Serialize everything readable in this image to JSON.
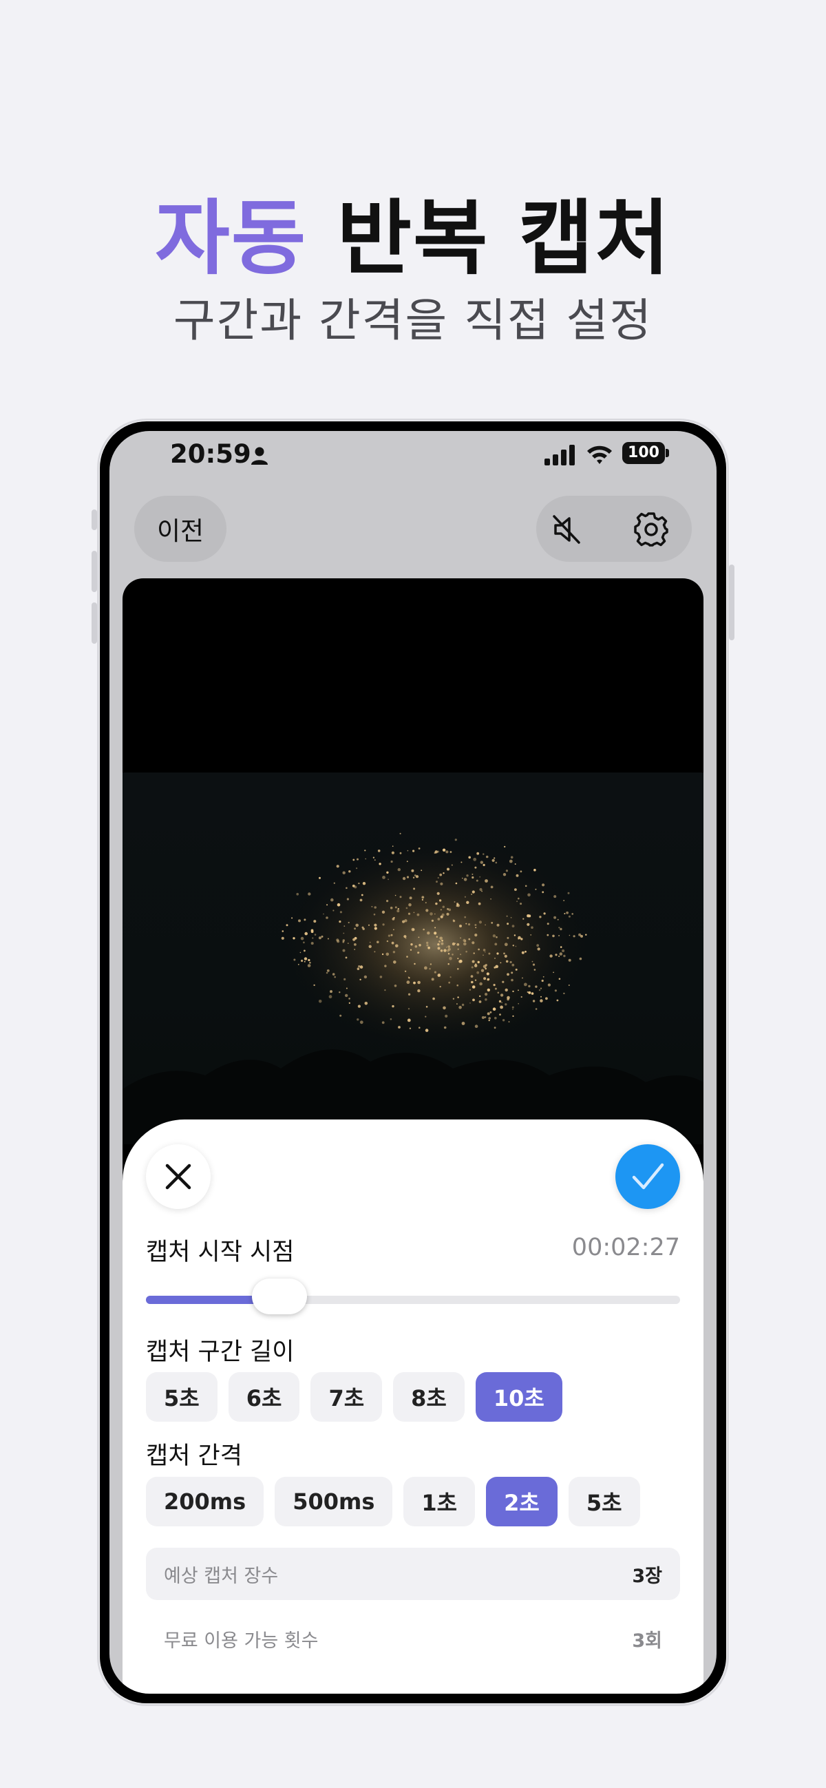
{
  "headline": {
    "accent": "자동",
    "rest": " 반복 캡처"
  },
  "subhead": "구간과 간격을 직접 설정",
  "status_bar": {
    "time": "20:59",
    "battery": "100"
  },
  "nav": {
    "back_label": "이전"
  },
  "sheet": {
    "start_label": "캡처 시작 시점",
    "start_time": "00:02:27",
    "start_progress": 0.25,
    "length_label": "캡처 구간 길이",
    "length_options": [
      "5초",
      "6초",
      "7초",
      "8초",
      "10초"
    ],
    "length_selected": "10초",
    "interval_label": "캡처 간격",
    "interval_options": [
      "200ms",
      "500ms",
      "1초",
      "2초",
      "5초"
    ],
    "interval_selected": "2초",
    "expected_label": "예상 캡처 장수",
    "expected_value": "3장",
    "free_label": "무료 이용 가능 횟수",
    "free_value": "3회"
  },
  "colors": {
    "accent": "#7f6bde",
    "chip_selected": "#6a6bd8",
    "confirm": "#1d96f3"
  }
}
